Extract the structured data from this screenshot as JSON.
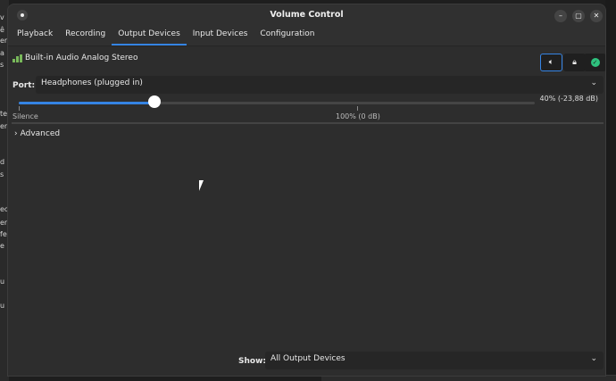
{
  "window": {
    "title": "Volume Control"
  },
  "tabs": [
    {
      "label": "Playback",
      "active": false
    },
    {
      "label": "Recording",
      "active": false
    },
    {
      "label": "Output Devices",
      "active": true
    },
    {
      "label": "Input Devices",
      "active": false
    },
    {
      "label": "Configuration",
      "active": false
    }
  ],
  "device": {
    "name": "Built-in Audio Analog Stereo",
    "port_label": "Port:",
    "port_value": "Headphones (plugged in)",
    "volume_percent": 40,
    "volume_text": "40% (-23,88 dB)",
    "mark_silence": "Silence",
    "mark_full": "100% (0 dB)",
    "advanced_label": "Advanced"
  },
  "footer": {
    "show_label": "Show:",
    "show_value": "All Output Devices"
  },
  "colors": {
    "accent": "#3584e4",
    "default_check": "#2ec27e",
    "device_icon": "#78b85a"
  }
}
